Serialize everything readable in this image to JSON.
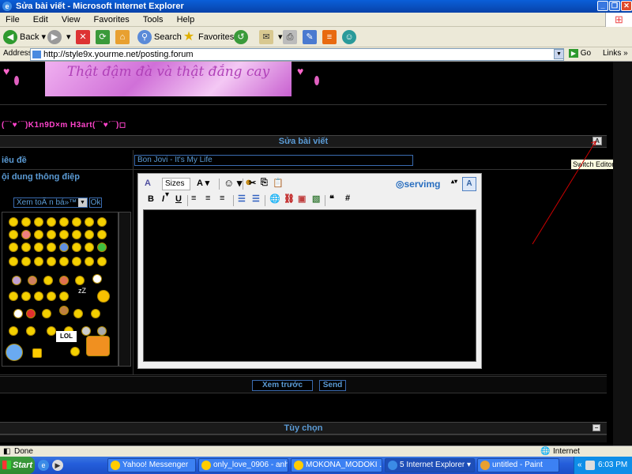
{
  "window": {
    "title": "Sửa bài viết - Microsoft Internet Explorer"
  },
  "menu": [
    "File",
    "Edit",
    "View",
    "Favorites",
    "Tools",
    "Help"
  ],
  "toolbar": {
    "back": "Back",
    "search": "Search",
    "favorites": "Favorites"
  },
  "address": {
    "label": "Address",
    "url": "http://style9x.yourme.net/posting.forum",
    "go": "Go",
    "links": "Links"
  },
  "page": {
    "banner_text": "Thật đậm đà và thật đắng cay",
    "site_name": "(¯`♥´¯)K1n9D×m H3art(¯`♥´¯)◻",
    "section_title": "Sửa bài viết",
    "subject_label": "iêu đề",
    "subject_value": "Bon Jovi - It's My Life",
    "content_label": "ội dung thông điệp",
    "emoticon_select": "Xem toÃ n bá»™",
    "ok": "Ok",
    "tooltip": "Switch Editor Mode",
    "preview_btn": "Xem trước",
    "send_btn": "Send",
    "options": "Tùy chọn"
  },
  "editor": {
    "sizes": "Sizes",
    "bold": "B",
    "italic": "I",
    "underline": "U",
    "servimg": "servimg"
  },
  "status": {
    "text": "Done",
    "zone": "Internet"
  },
  "taskbar": {
    "start": "Start",
    "tasks": [
      "Yahoo! Messenger",
      "only_love_0906 - anh...",
      "MOKONA_MODOKI . (...",
      "5 Internet Explorer",
      "untitled - Paint"
    ],
    "clock": "6:03 PM"
  }
}
